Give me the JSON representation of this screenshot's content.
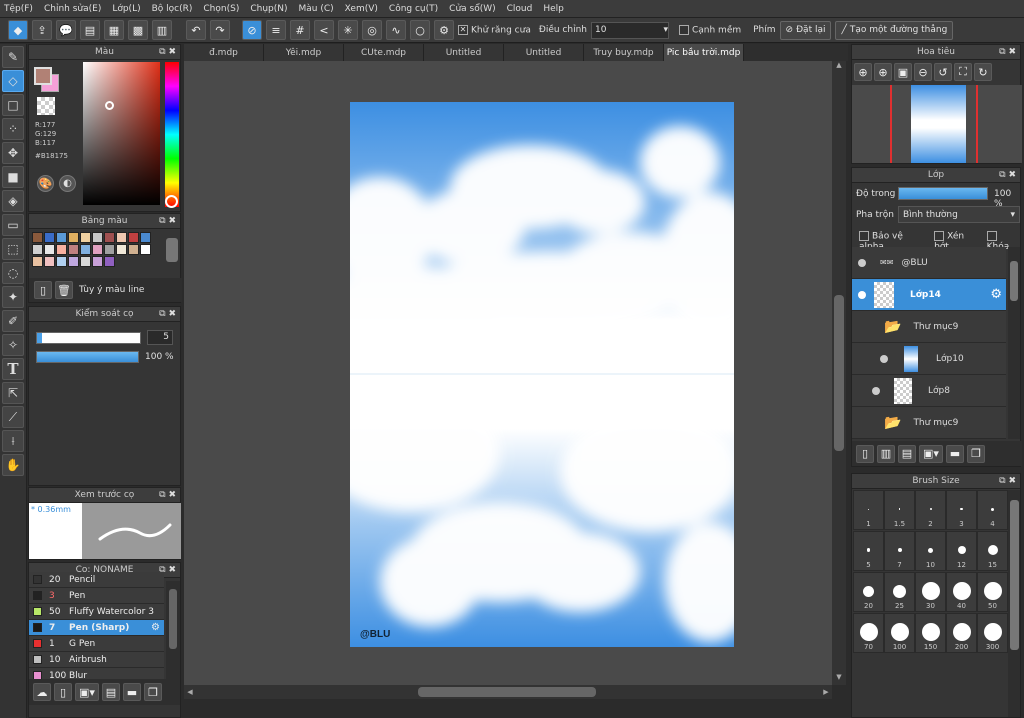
{
  "menu": [
    "Tệp(F)",
    "Chỉnh sửa(E)",
    "Lớp(L)",
    "Bộ lọc(R)",
    "Chọn(S)",
    "Chụp(N)",
    "Màu (C)",
    "Xem(V)",
    "Công cụ(T)",
    "Cửa sổ(W)",
    "Cloud",
    "Help"
  ],
  "toolbar": {
    "antialias_label": "Khử răng cưa",
    "adjust_label": "Điều chỉnh",
    "adjust_value": "10",
    "soft_edge_label": "Cạnh mềm",
    "key_label": "Phím",
    "reset_label": "Đặt lại",
    "straight_line_label": "Tạo một đường thẳng"
  },
  "color_panel": {
    "title": "Màu",
    "r": "R:177",
    "g": "G:129",
    "b": "B:117",
    "hex": "#B18175",
    "main_color": "#b18175",
    "sub_color": "#f5a0d8"
  },
  "palette_panel": {
    "title": "Bảng màu",
    "custom_label": "Tùy ý màu line",
    "swatches": [
      "#8b5a3c",
      "#3a6cc8",
      "#5a9ad8",
      "#e0b060",
      "#f0d0a0",
      "#c8c8c8",
      "#a05050",
      "#f0c8b0",
      "#c04040",
      "#4a8ad0",
      "#d0d0d0",
      "#e8e8e8",
      "#f8b0a0",
      "#c08080",
      "#80b0e0",
      "#e0a0c0",
      "#a0a0a0",
      "#f0e8d8",
      "#d0b090",
      "#ffffff",
      "#e8c0a0",
      "#f0c0c0",
      "#b0d0f0",
      "#c0a8e0",
      "#d8d8d8",
      "#c8a0d8",
      "#9060c0"
    ]
  },
  "brush_control": {
    "title": "Kiểm soát cọ",
    "size": "5",
    "opacity": "100 %",
    "size_fraction": 0.05,
    "opacity_fraction": 1.0
  },
  "brush_preview": {
    "title": "Xem trước cọ",
    "size_text": "* 0.36mm"
  },
  "brush_list": {
    "title": "Cọ: NONAME",
    "items": [
      {
        "size": "20",
        "name": "Pencil",
        "color": "#333333"
      },
      {
        "size": "3",
        "name": "Pen",
        "color": "#222222"
      },
      {
        "size": "50",
        "name": "Fluffy Watercolor 3",
        "color": "#b8e868"
      },
      {
        "size": "7",
        "name": "Pen (Sharp)",
        "color": "#1a1a1a"
      },
      {
        "size": "1",
        "name": "G Pen",
        "color": "#e83030"
      },
      {
        "size": "10",
        "name": "Airbrush",
        "color": "#c0c0c0"
      },
      {
        "size": "100",
        "name": "Blur",
        "color": "#e890d0"
      }
    ]
  },
  "tabs": [
    "đ.mdp",
    "Yêi.mdp",
    "CUte.mdp",
    "Untitled",
    "Untitled",
    "Truy buy.mdp",
    "Pic bầu trời.mdp"
  ],
  "canvas": {
    "signature": "@BLU"
  },
  "navigator": {
    "title": "Hoa tiêu"
  },
  "layers_panel": {
    "title": "Lớp",
    "opacity_label": "Độ trong",
    "opacity_value": "100 %",
    "opacity_fraction": 1.0,
    "blend_label": "Pha trộn",
    "blend_value": "Bình thường",
    "protect_alpha": "Bảo vệ alpha",
    "clipping": "Xén bớt",
    "lock": "Khóa",
    "layers": [
      {
        "name": "@BLU",
        "type": "text"
      },
      {
        "name": "Lớp14",
        "type": "layer"
      },
      {
        "name": "Thư mục9",
        "type": "folder"
      },
      {
        "name": "Lớp10",
        "type": "layer"
      },
      {
        "name": "Lớp8",
        "type": "layer"
      },
      {
        "name": "Thư mục9",
        "type": "folder"
      }
    ]
  },
  "brush_size_panel": {
    "title": "Brush Size",
    "sizes": [
      "1",
      "1.5",
      "2",
      "3",
      "4",
      "5",
      "7",
      "10",
      "12",
      "15",
      "20",
      "25",
      "30",
      "40",
      "50",
      "70",
      "100",
      "150",
      "200",
      "300"
    ]
  }
}
